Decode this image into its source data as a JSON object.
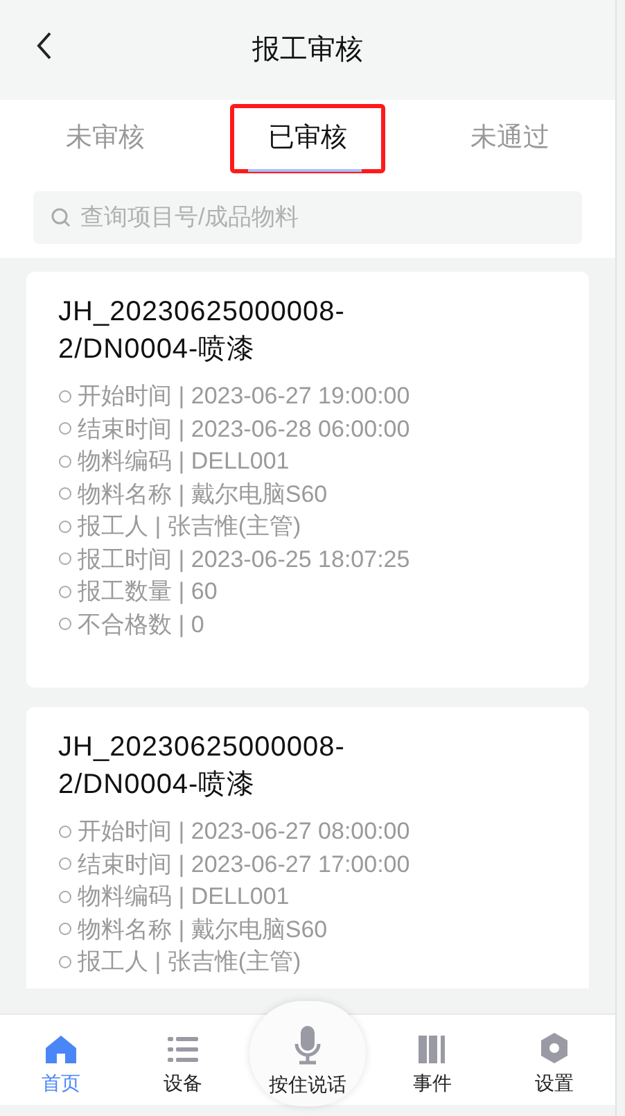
{
  "header": {
    "title": "报工审核"
  },
  "tabs": [
    {
      "label": "未审核",
      "selected": false,
      "highlighted": false
    },
    {
      "label": "已审核",
      "selected": true,
      "highlighted": true
    },
    {
      "label": "未通过",
      "selected": false,
      "highlighted": false
    }
  ],
  "search": {
    "placeholder": "查询项目号/成品物料"
  },
  "cards": [
    {
      "title": "JH_20230625000008-2/DN0004-喷漆",
      "fields": [
        "开始时间 | 2023-06-27 19:00:00",
        "结束时间 | 2023-06-28 06:00:00",
        "物料编码 | DELL001",
        "物料名称 | 戴尔电脑S60",
        "报工人 | 张吉惟(主管)",
        "报工时间 | 2023-06-25 18:07:25",
        "报工数量 | 60",
        "不合格数 | 0"
      ]
    },
    {
      "title": "JH_20230625000008-2/DN0004-喷漆",
      "fields": [
        "开始时间 | 2023-06-27 08:00:00",
        "结束时间 | 2023-06-27 17:00:00",
        "物料编码 | DELL001",
        "物料名称 | 戴尔电脑S60",
        "报工人 | 张吉惟(主管)"
      ]
    }
  ],
  "nav": [
    {
      "label": "首页",
      "kind": "home",
      "selected": true
    },
    {
      "label": "设备",
      "kind": "list",
      "selected": false
    },
    {
      "label": "按住说话",
      "kind": "mic",
      "selected": false
    },
    {
      "label": "事件",
      "kind": "books",
      "selected": false
    },
    {
      "label": "设置",
      "kind": "hex",
      "selected": false
    }
  ]
}
